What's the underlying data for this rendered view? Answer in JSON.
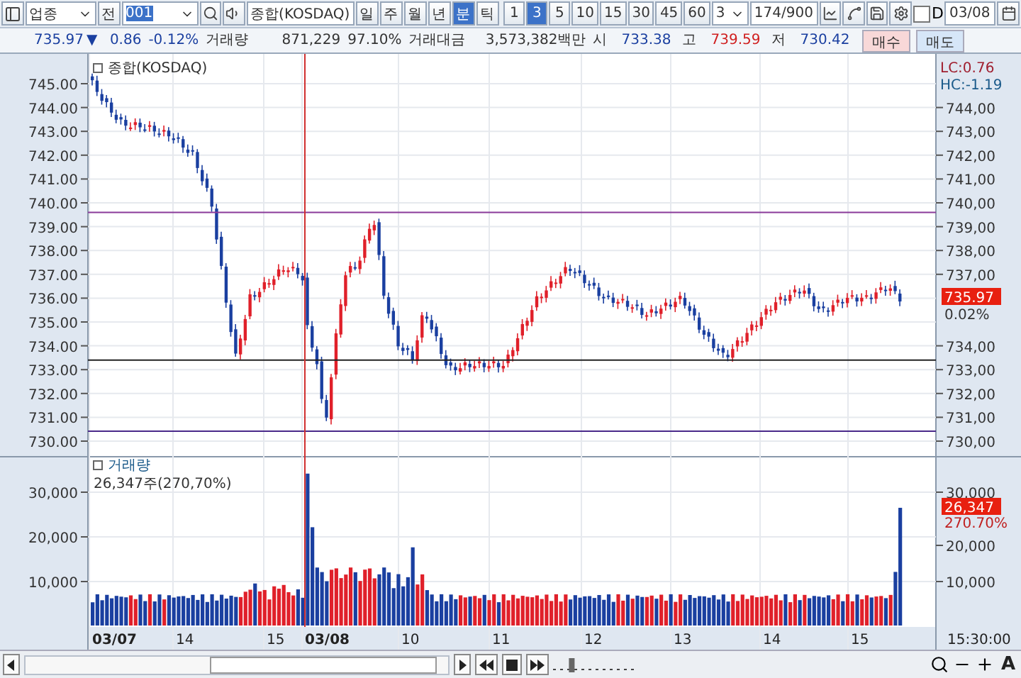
{
  "toolbar": {
    "market": {
      "value": "업종"
    },
    "all_button": "전",
    "code": {
      "value": "001"
    },
    "name": "종합(KOSDAQ)",
    "periods": [
      {
        "label": "일",
        "selected": false
      },
      {
        "label": "주",
        "selected": false
      },
      {
        "label": "월",
        "selected": false
      },
      {
        "label": "년",
        "selected": false
      },
      {
        "label": "분",
        "selected": true
      },
      {
        "label": "틱",
        "selected": false
      }
    ],
    "intervals": [
      {
        "label": "1",
        "selected": false
      },
      {
        "label": "3",
        "selected": true
      },
      {
        "label": "5",
        "selected": false
      },
      {
        "label": "10",
        "selected": false
      },
      {
        "label": "15",
        "selected": false
      },
      {
        "label": "30",
        "selected": false
      },
      {
        "label": "45",
        "selected": false
      },
      {
        "label": "60",
        "selected": false
      }
    ],
    "count": {
      "value": "3"
    },
    "range": "174/900",
    "d_checkbox": {
      "label": "D",
      "checked": false
    },
    "date": "03/08"
  },
  "quote": {
    "price": "735.97",
    "arrow": "▼",
    "change": "0.86",
    "change_pct": "-0.12%",
    "volume_label": "거래량",
    "volume": "871,229",
    "volume_ratio": "97.10%",
    "amount_label": "거래대금",
    "amount": "3,573,382백만",
    "open_label": "시",
    "open": "733.38",
    "high_label": "고",
    "high": "739.59",
    "low_label": "저",
    "low": "730.42",
    "buy": "매수",
    "sell": "매도"
  },
  "price_panel": {
    "legend": "종합(KOSDAQ)",
    "left_ticks": [
      "745.00",
      "744.00",
      "743.00",
      "742.00",
      "741.00",
      "740.00",
      "739.00",
      "738.00",
      "737.00",
      "736.00",
      "735.00",
      "734.00",
      "733.00",
      "732.00",
      "731.00",
      "730.00"
    ],
    "right_ticks": [
      "744,00",
      "743,00",
      "742,00",
      "741,00",
      "740,00",
      "739,00",
      "738,00",
      "737,00",
      "734,00",
      "733,00",
      "732,00",
      "731,00",
      "730,00"
    ],
    "lc": "LC:0.76",
    "hc": "HC:-1.19",
    "last_price": "735.97",
    "last_change": "0.02%"
  },
  "volume_panel": {
    "legend": "거래량",
    "summary": "26,347주(270,70%)",
    "left_ticks": [
      "30,000",
      "20,000",
      "10,000"
    ],
    "right_ticks": [
      "30,000",
      "20,000",
      "10,000"
    ],
    "last_volume": "26,347",
    "last_ratio": "270.70%"
  },
  "time_axis": {
    "labels": [
      "03/07",
      "14",
      "15",
      "03/08",
      "10",
      "11",
      "12",
      "13",
      "14",
      "15"
    ],
    "end_time": "15:30:00"
  },
  "bottom_bar": {
    "zoom": {
      "level": 0.2
    },
    "font_button": "A"
  }
}
